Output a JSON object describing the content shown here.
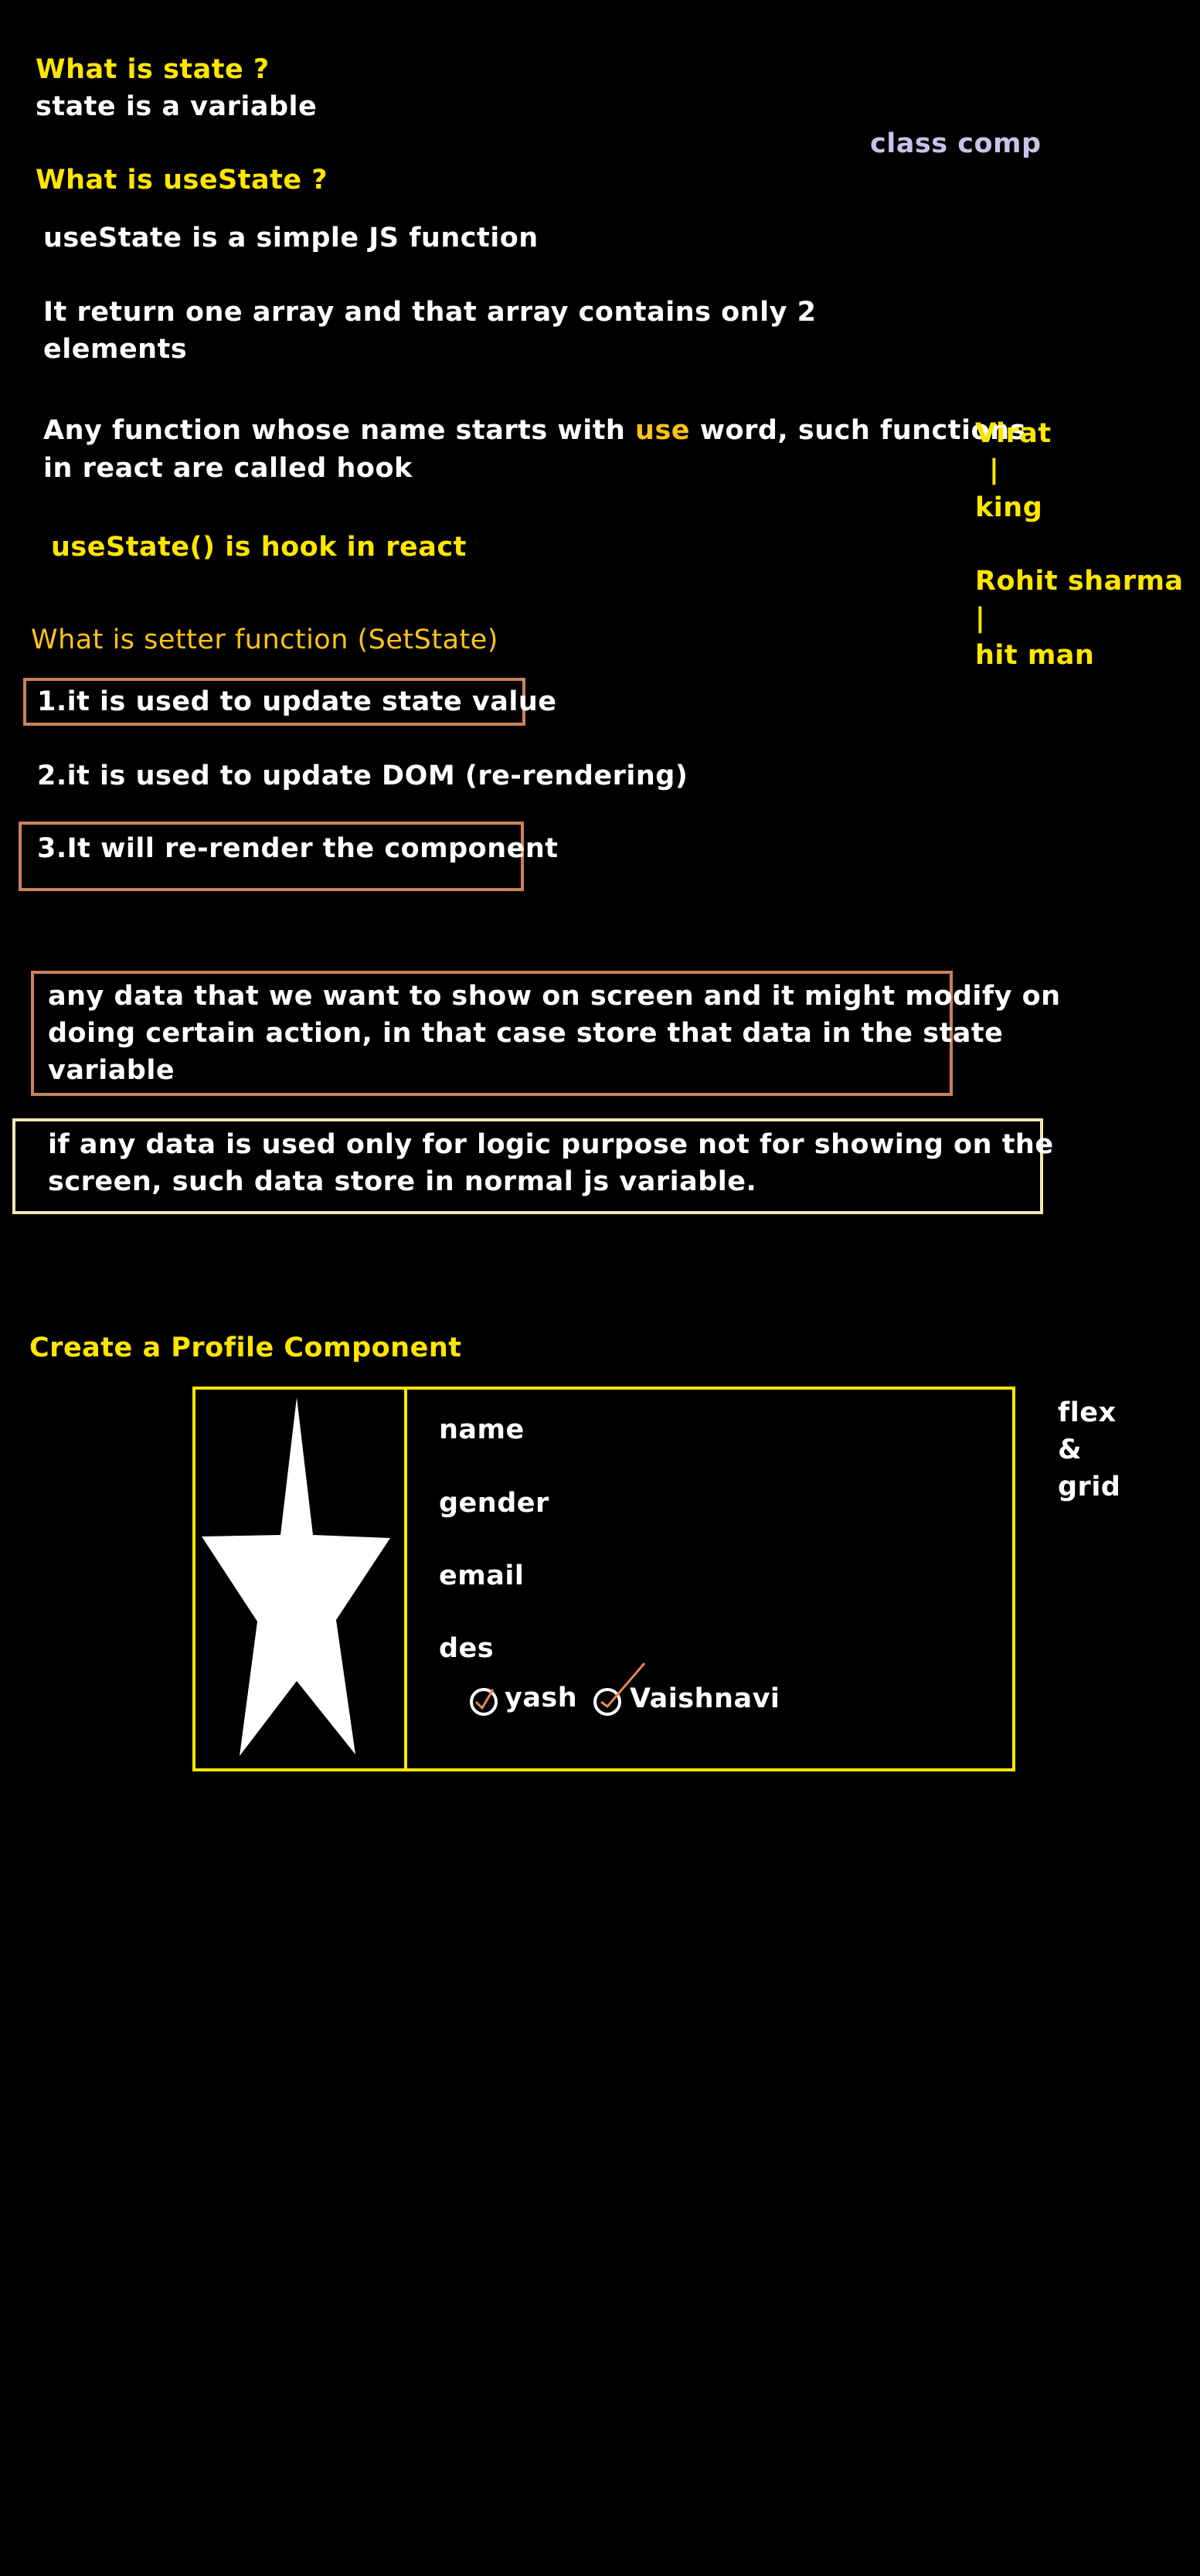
{
  "state": {
    "heading": "What is state ?",
    "line": "state is a variable"
  },
  "side_note": "class comp",
  "usestate": {
    "heading": "What is useState ?",
    "line1": "useState is a simple JS function",
    "line2a": "It return one array and that array contains only 2",
    "line2b": "elements",
    "line3a_pre": "Any function whose name starts with ",
    "line3a_hl": "use",
    "line3a_post": " word, such functions",
    "line3b": "in react are called hook",
    "hook_line": "useState() is hook in react"
  },
  "example": {
    "name1": "Virat",
    "bar1": "|",
    "nick1": "king",
    "name2": "Rohit sharma",
    "bar2": "|",
    "nick2": "hit man"
  },
  "setter": {
    "heading": "What is setter function (SetState)",
    "point1": "1.it is used to update state value",
    "point2": "2.it is used to update DOM (re-rendering)",
    "point3": "3.It will re-render the component"
  },
  "notes": {
    "state_box": [
      "any data that we want to show on screen and it might modify on",
      "doing certain action, in that case store that data in the state",
      "variable"
    ],
    "js_box": [
      "if any data is used only for logic purpose not for showing on the",
      "screen, such data store in normal js variable."
    ]
  },
  "profile": {
    "heading": "Create a Profile Component",
    "fields": [
      "name",
      "gender",
      "email",
      "des"
    ],
    "options": [
      "yash",
      "Vaishnavi"
    ],
    "layout_note": [
      "flex",
      "&",
      "grid"
    ]
  },
  "colors": {
    "heading_yellow": "#ffe600",
    "box_brown": "#c8835a",
    "box_cream": "#f3e7b4",
    "highlight_orange": "#ffc21a",
    "note_lavender": "#c7c3e8"
  }
}
